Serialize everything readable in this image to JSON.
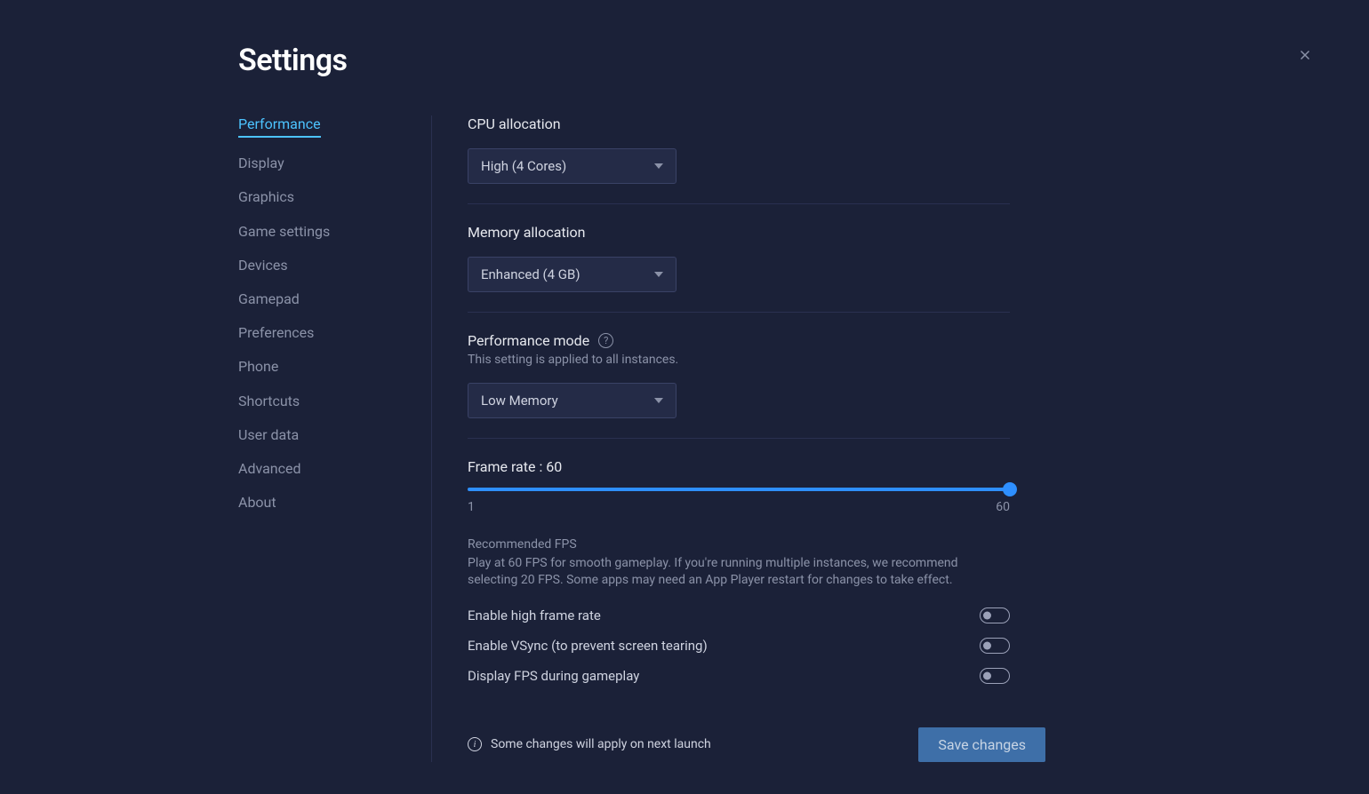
{
  "title": "Settings",
  "sidebar": {
    "items": [
      {
        "label": "Performance",
        "active": true
      },
      {
        "label": "Display"
      },
      {
        "label": "Graphics"
      },
      {
        "label": "Game settings"
      },
      {
        "label": "Devices"
      },
      {
        "label": "Gamepad"
      },
      {
        "label": "Preferences"
      },
      {
        "label": "Phone"
      },
      {
        "label": "Shortcuts"
      },
      {
        "label": "User data"
      },
      {
        "label": "Advanced"
      },
      {
        "label": "About"
      }
    ]
  },
  "cpu": {
    "label": "CPU allocation",
    "value": "High (4 Cores)"
  },
  "memory": {
    "label": "Memory allocation",
    "value": "Enhanced (4 GB)"
  },
  "perfmode": {
    "label": "Performance mode",
    "sub": "This setting is applied to all instances.",
    "value": "Low Memory"
  },
  "framerate": {
    "label_prefix": "Frame rate :",
    "value": "60",
    "min": "1",
    "max": "60",
    "recommended_title": "Recommended FPS",
    "recommended_body": "Play at 60 FPS for smooth gameplay. If you're running multiple instances, we recommend selecting 20 FPS. Some apps may need an App Player restart for changes to take effect."
  },
  "toggles": {
    "high_frame": "Enable high frame rate",
    "vsync": "Enable VSync (to prevent screen tearing)",
    "display_fps": "Display FPS during gameplay"
  },
  "footer": {
    "note": "Some changes will apply on next launch",
    "save": "Save changes"
  }
}
